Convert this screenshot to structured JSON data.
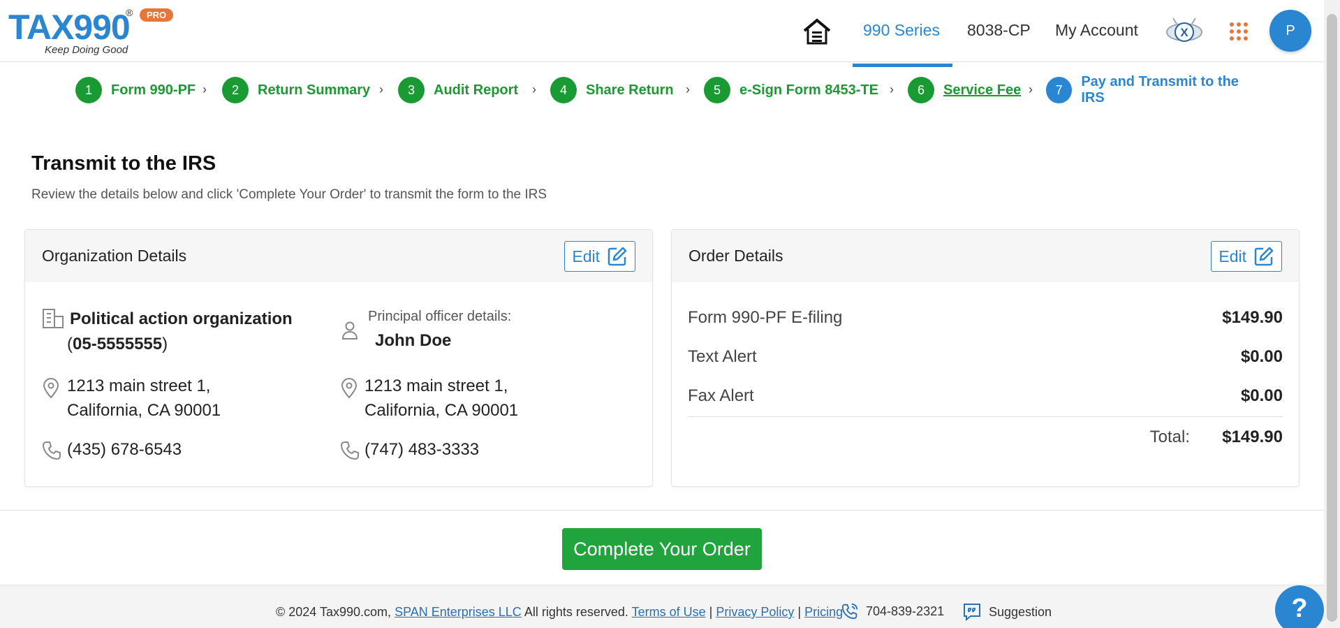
{
  "header": {
    "logo": {
      "text": "TAX990",
      "reg": "®",
      "badge": "PRO",
      "tagline": "Keep Doing Good"
    },
    "nav": [
      {
        "label": "990 Series",
        "active": true
      },
      {
        "label": "8038-CP"
      },
      {
        "label": "My Account"
      }
    ],
    "avatar_initial": "P",
    "icons": [
      "home-icon",
      "x-badge-icon",
      "apps-grid-icon"
    ]
  },
  "stepper": [
    {
      "num": "1",
      "label": "Form 990-PF"
    },
    {
      "num": "2",
      "label": "Return Summary"
    },
    {
      "num": "3",
      "label": "Audit Report"
    },
    {
      "num": "4",
      "label": "Share Return"
    },
    {
      "num": "5",
      "label": "e-Sign Form 8453-TE"
    },
    {
      "num": "6",
      "label": "Service Fee",
      "link": true
    },
    {
      "num": "7",
      "label": "Pay and Transmit to the IRS",
      "active": true
    }
  ],
  "page": {
    "title": "Transmit to the IRS",
    "subtitle": "Review the details below and click 'Complete Your Order' to transmit the form to the IRS"
  },
  "org_card": {
    "title": "Organization Details",
    "edit_label": "Edit",
    "org_name": "Political action organization",
    "ein_open": "(",
    "ein": "05-5555555",
    "ein_close": ")",
    "org_address_line1": "1213 main street 1,",
    "org_address_line2": "California, CA 90001",
    "org_phone": "(435) 678-6543",
    "officer_label": "Principal officer details:",
    "officer_name": "John Doe",
    "officer_address_line1": "1213 main street 1,",
    "officer_address_line2": "California, CA 90001",
    "officer_phone": "(747) 483-3333"
  },
  "order_card": {
    "title": "Order Details",
    "edit_label": "Edit",
    "items": [
      {
        "label": "Form 990-PF E-filing",
        "value": "$149.90"
      },
      {
        "label": "Text Alert",
        "value": "$0.00"
      },
      {
        "label": "Fax Alert",
        "value": "$0.00"
      }
    ],
    "total_label": "Total:",
    "total_value": "$149.90"
  },
  "action": {
    "complete_label": "Complete Your Order"
  },
  "footer": {
    "copyright": "© 2024 Tax990.com,",
    "span_link": "SPAN Enterprises LLC",
    "rights": "All rights reserved.",
    "terms": "Terms of Use",
    "sep1": "|",
    "privacy": "Privacy Policy",
    "sep2": "|",
    "pricing": "Pricing",
    "phone": "704-839-2321",
    "suggestion": "Suggestion"
  },
  "help_label": "?",
  "colors": {
    "brand_blue": "#2a86d1",
    "step_green": "#1a9a32",
    "cta_green": "#21a43e",
    "pro_orange": "#e8763a"
  }
}
